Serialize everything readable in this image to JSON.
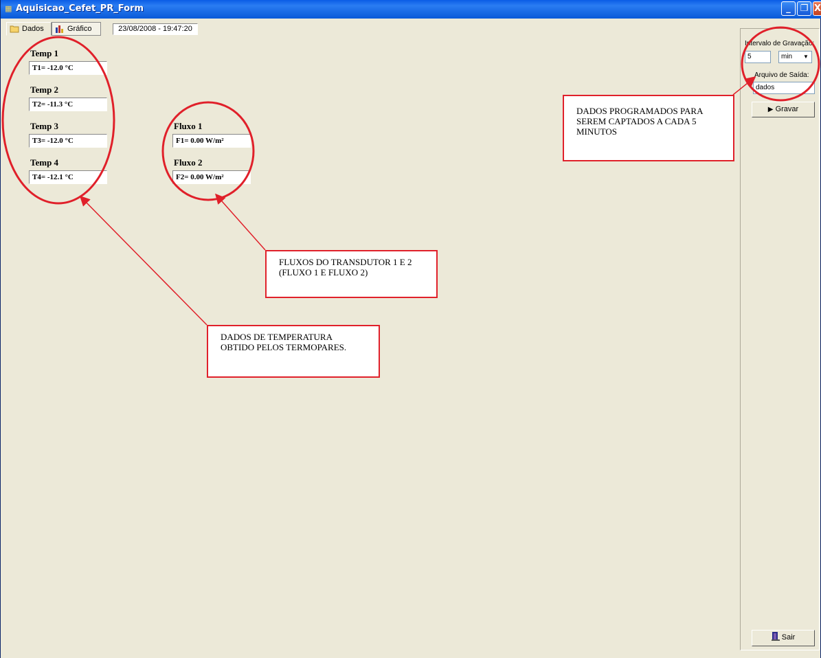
{
  "window": {
    "title": "Aquisicao_Cefet_PR_Form",
    "buttons": {
      "minimize": "_",
      "restore": "❐",
      "close": "X"
    }
  },
  "tabs": [
    {
      "label": "Dados"
    },
    {
      "label": "Gráfico"
    }
  ],
  "datetime": "23/08/2008 - 19:47:20",
  "temperatures": [
    {
      "label": "Temp 1",
      "value": "T1= -12.0 °C"
    },
    {
      "label": "Temp 2",
      "value": "T2= -11.3 °C"
    },
    {
      "label": "Temp 3",
      "value": "T3= -12.0 °C"
    },
    {
      "label": "Temp 4",
      "value": "T4= -12.1 °C"
    }
  ],
  "fluxes": [
    {
      "label": "Fluxo 1",
      "value": "F1= 0.00 W/m²"
    },
    {
      "label": "Fluxo 2",
      "value": "F2= 0.00 W/m²"
    }
  ],
  "recording": {
    "interval_label": "Intervalo de Gravação:",
    "interval_value": "5",
    "unit_value": "min",
    "output_label": "Arquivo de Saída:",
    "output_value": "dados",
    "save_button": "Gravar",
    "exit_button": "Sair"
  },
  "annotations": {
    "temperature_note": "DADOS DE TEMPERATURA OBTIDO PELOS TERMOPARES.",
    "flux_note": "FLUXOS DO TRANSDUTOR 1 E 2 (FLUXO 1 E FLUXO 2)",
    "program_note": "DADOS PROGRAMADOS PARA SEREM CAPTADOS A CADA 5 MINUTOS",
    "color": "#e0202a"
  }
}
